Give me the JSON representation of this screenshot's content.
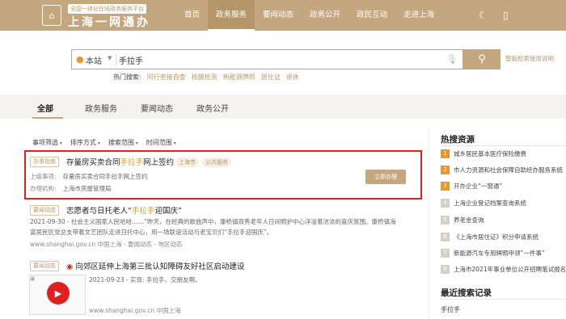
{
  "header": {
    "logo_tag": "全国一体化在线政务服务平台",
    "logo_title": "上海一网通办",
    "nav": [
      "首页",
      "政务服务",
      "要闻动态",
      "政务公开",
      "政民互动",
      "走进上海"
    ],
    "active_nav": 1
  },
  "search": {
    "location": "本站",
    "query": "手拉手",
    "help": "智能检索使用说明",
    "hot_label": "热门搜索:",
    "hot_items": [
      "同行密接自查",
      "核酸检测",
      "新能源牌照",
      "居住证",
      "退休"
    ]
  },
  "tabs": [
    "全部",
    "政务服务",
    "要闻动态",
    "政务公开"
  ],
  "filters": [
    "事项筛选",
    "排序方式",
    "搜索范围",
    "时间范围"
  ],
  "results": {
    "r1": {
      "badge": "办事指南",
      "title_pre": "存量房买卖合同",
      "title_hl": "手拉手",
      "title_post": "网上签约",
      "tags": [
        "上海市",
        "公共服务"
      ],
      "k1": "上级事项:",
      "v1": "存量房买卖合同手拉手网上签约",
      "k2": "办理机构:",
      "v2": "上海市房屋管理局",
      "apply": "立即办理"
    },
    "r2": {
      "badge": "要闻动态",
      "title_pre": "志愿者与日托老人“",
      "title_hl": "手拉手",
      "title_post": "迎国庆”",
      "snip1": "2021-09-30 - 社会主义国家人民哈哈……”昨天，在经典的歌曲声中，康桥镇双秀老年人日间照护中心洋溢着浓浓的喜庆氛围。康桥镇海",
      "snip2": "富居民区党总支带着文艺团队走进日托中心，用一场联谊活动与老宝贝们“手拉手迎国庆”。",
      "url": "www.shanghai.gov.cn  中国上海 - 要闻动态 - 地区动态"
    },
    "r3": {
      "badge": "要闻动态",
      "title": "向郊区延伸上海第三批认知障碍友好社区启动建设",
      "snip": "2021-09-23 - 实现: 手拉手、交朋友啊。",
      "url": "www.shanghai.gov.cn  中国上海"
    }
  },
  "sidebar": {
    "hot_title": "热搜资源",
    "hot_items": [
      {
        "n": "1",
        "t": "城乡居民基本医疗保险缴费"
      },
      {
        "n": "2",
        "t": "市人力资源和社会保障自助经办服务系统"
      },
      {
        "n": "3",
        "t": "开办企业“一窗通”"
      },
      {
        "n": "4",
        "t": "上海企业登记档案查询系统"
      },
      {
        "n": "5",
        "t": "养老金查询"
      },
      {
        "n": "6",
        "t": "《上海市居住证》积分申请系统"
      },
      {
        "n": "7",
        "t": "新能源汽车专用牌照申领“一件事”"
      },
      {
        "n": "8",
        "t": "上海市2021年事业单位公开招聘笔试报名"
      }
    ],
    "recent_title": "最近搜索记录",
    "recent_item": "手拉手"
  },
  "colors": {
    "brand": "#c4a77f",
    "highlight": "#d39b3a",
    "alert": "#e02020",
    "hot_num": "#e8962e"
  }
}
